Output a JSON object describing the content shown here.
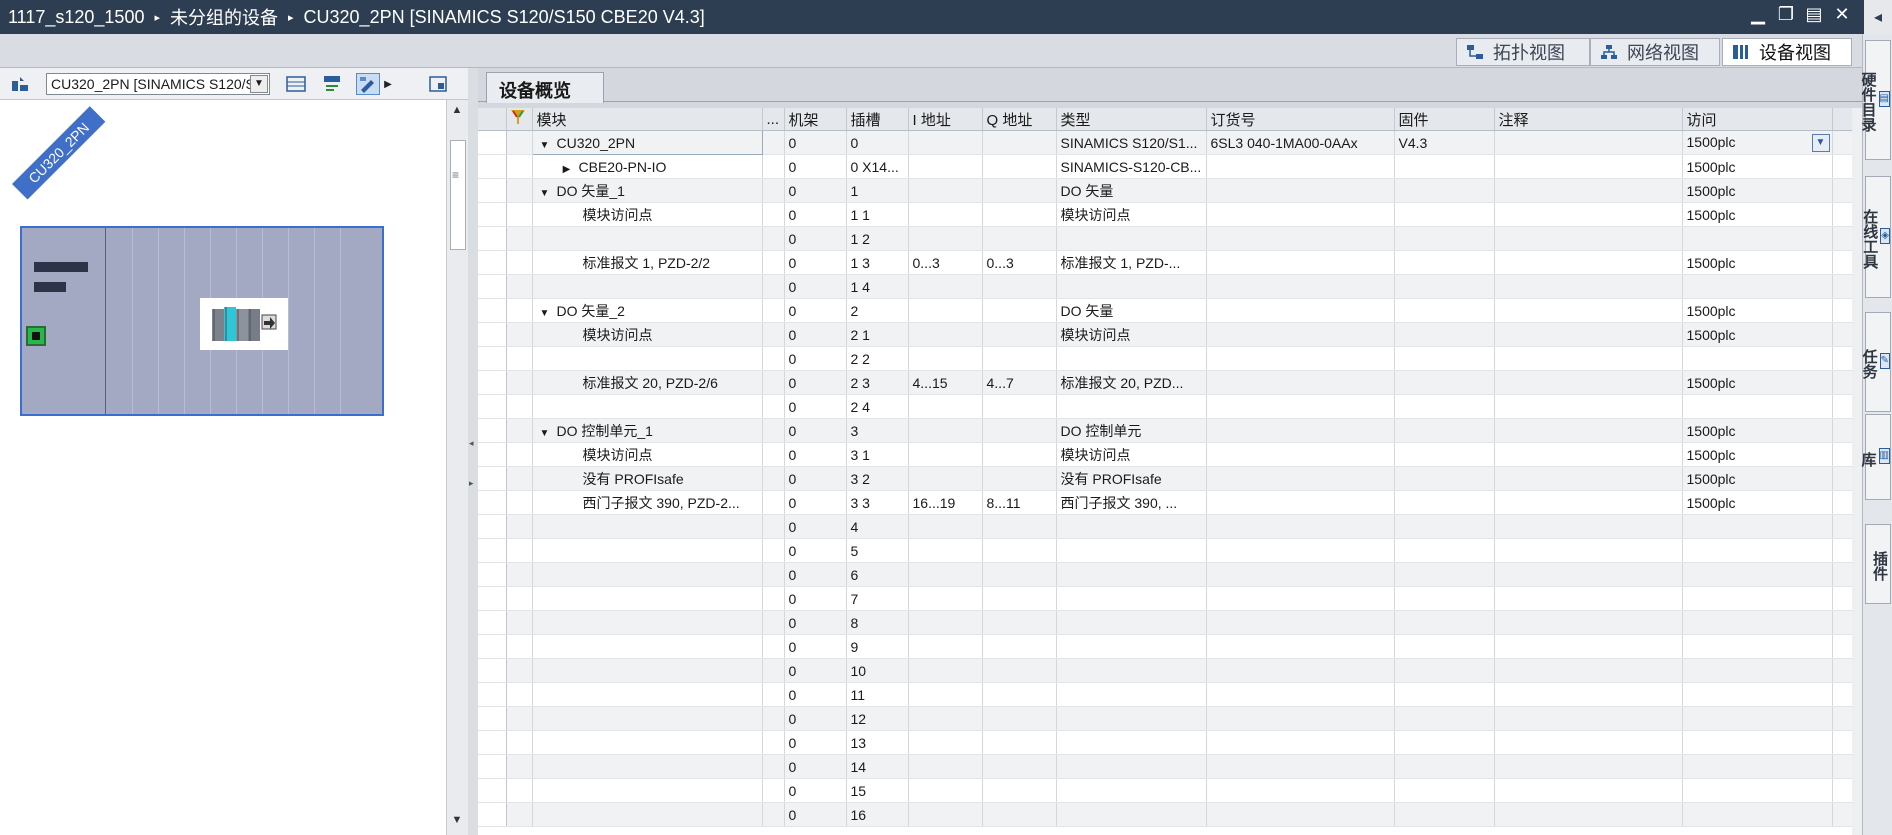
{
  "titlebar": {
    "crumbs": [
      "1117_s120_1500",
      "未分组的设备",
      "CU320_2PN [SINAMICS S120/S150 CBE20 V4.3]"
    ],
    "separator": "▸",
    "min": "▁",
    "restore": "❐",
    "tile": "▤",
    "close": "✕",
    "collapse": "◂"
  },
  "viewtabs": [
    {
      "label": "拓扑视图",
      "icon": "topology-icon"
    },
    {
      "label": "网络视图",
      "icon": "network-icon"
    },
    {
      "label": "设备视图",
      "icon": "device-icon",
      "active": true
    }
  ],
  "left": {
    "device_select": "CU320_2PN [SINAMICS S120/S",
    "device_label": "CU320_2PN"
  },
  "table_tab": "设备概览",
  "columns": {
    "module": "模块",
    "dots": "...",
    "rack": "机架",
    "slot": "插槽",
    "iaddr": "I 地址",
    "qaddr": "Q 地址",
    "type": "类型",
    "order": "订货号",
    "firmware": "固件",
    "comment": "注释",
    "access": "访问"
  },
  "rows": [
    {
      "module": "CU320_2PN",
      "expand": "▼",
      "level": 0,
      "rack": "0",
      "slot": "0",
      "i": "",
      "q": "",
      "type": "SINAMICS S120/S1...",
      "order": "6SL3 040-1MA00-0AAx",
      "fw": "V4.3",
      "comment": "",
      "access": "1500plc",
      "selected": true
    },
    {
      "module": "CBE20-PN-IO",
      "expand": "▶",
      "level": 1,
      "rack": "0",
      "slot": "0 X14...",
      "i": "",
      "q": "",
      "type": "SINAMICS-S120-CB...",
      "order": "",
      "fw": "",
      "comment": "",
      "access": "1500plc"
    },
    {
      "module": "DO 矢量_1",
      "expand": "▼",
      "level": 0,
      "rack": "0",
      "slot": "1",
      "i": "",
      "q": "",
      "type": "DO 矢量",
      "order": "",
      "fw": "",
      "comment": "",
      "access": "1500plc"
    },
    {
      "module": "模块访问点",
      "expand": "",
      "level": 1,
      "rack": "0",
      "slot": "1 1",
      "i": "",
      "q": "",
      "type": "模块访问点",
      "order": "",
      "fw": "",
      "comment": "",
      "access": "1500plc"
    },
    {
      "module": "",
      "expand": "",
      "level": 1,
      "rack": "0",
      "slot": "1 2",
      "i": "",
      "q": "",
      "type": "",
      "order": "",
      "fw": "",
      "comment": "",
      "access": ""
    },
    {
      "module": "标准报文 1, PZD-2/2",
      "expand": "",
      "level": 1,
      "rack": "0",
      "slot": "1 3",
      "i": "0...3",
      "q": "0...3",
      "type": "标准报文 1, PZD-...",
      "order": "",
      "fw": "",
      "comment": "",
      "access": "1500plc"
    },
    {
      "module": "",
      "expand": "",
      "level": 1,
      "rack": "0",
      "slot": "1 4",
      "i": "",
      "q": "",
      "type": "",
      "order": "",
      "fw": "",
      "comment": "",
      "access": ""
    },
    {
      "module": "DO 矢量_2",
      "expand": "▼",
      "level": 0,
      "rack": "0",
      "slot": "2",
      "i": "",
      "q": "",
      "type": "DO 矢量",
      "order": "",
      "fw": "",
      "comment": "",
      "access": "1500plc"
    },
    {
      "module": "模块访问点",
      "expand": "",
      "level": 1,
      "rack": "0",
      "slot": "2 1",
      "i": "",
      "q": "",
      "type": "模块访问点",
      "order": "",
      "fw": "",
      "comment": "",
      "access": "1500plc"
    },
    {
      "module": "",
      "expand": "",
      "level": 1,
      "rack": "0",
      "slot": "2 2",
      "i": "",
      "q": "",
      "type": "",
      "order": "",
      "fw": "",
      "comment": "",
      "access": ""
    },
    {
      "module": "标准报文 20, PZD-2/6",
      "expand": "",
      "level": 1,
      "rack": "0",
      "slot": "2 3",
      "i": "4...15",
      "q": "4...7",
      "type": "标准报文 20, PZD...",
      "order": "",
      "fw": "",
      "comment": "",
      "access": "1500plc"
    },
    {
      "module": "",
      "expand": "",
      "level": 1,
      "rack": "0",
      "slot": "2 4",
      "i": "",
      "q": "",
      "type": "",
      "order": "",
      "fw": "",
      "comment": "",
      "access": ""
    },
    {
      "module": "DO 控制单元_1",
      "expand": "▼",
      "level": 0,
      "rack": "0",
      "slot": "3",
      "i": "",
      "q": "",
      "type": "DO 控制单元",
      "order": "",
      "fw": "",
      "comment": "",
      "access": "1500plc"
    },
    {
      "module": "模块访问点",
      "expand": "",
      "level": 1,
      "rack": "0",
      "slot": "3 1",
      "i": "",
      "q": "",
      "type": "模块访问点",
      "order": "",
      "fw": "",
      "comment": "",
      "access": "1500plc"
    },
    {
      "module": "没有 PROFIsafe",
      "expand": "",
      "level": 1,
      "rack": "0",
      "slot": "3 2",
      "i": "",
      "q": "",
      "type": "没有 PROFIsafe",
      "order": "",
      "fw": "",
      "comment": "",
      "access": "1500plc"
    },
    {
      "module": "西门子报文 390, PZD-2...",
      "expand": "",
      "level": 1,
      "rack": "0",
      "slot": "3 3",
      "i": "16...19",
      "q": "8...11",
      "type": "西门子报文 390, ...",
      "order": "",
      "fw": "",
      "comment": "",
      "access": "1500plc"
    },
    {
      "module": "",
      "expand": "",
      "level": 0,
      "rack": "0",
      "slot": "4",
      "i": "",
      "q": "",
      "type": "",
      "order": "",
      "fw": "",
      "comment": "",
      "access": ""
    },
    {
      "module": "",
      "expand": "",
      "level": 0,
      "rack": "0",
      "slot": "5",
      "i": "",
      "q": "",
      "type": "",
      "order": "",
      "fw": "",
      "comment": "",
      "access": ""
    },
    {
      "module": "",
      "expand": "",
      "level": 0,
      "rack": "0",
      "slot": "6",
      "i": "",
      "q": "",
      "type": "",
      "order": "",
      "fw": "",
      "comment": "",
      "access": ""
    },
    {
      "module": "",
      "expand": "",
      "level": 0,
      "rack": "0",
      "slot": "7",
      "i": "",
      "q": "",
      "type": "",
      "order": "",
      "fw": "",
      "comment": "",
      "access": ""
    },
    {
      "module": "",
      "expand": "",
      "level": 0,
      "rack": "0",
      "slot": "8",
      "i": "",
      "q": "",
      "type": "",
      "order": "",
      "fw": "",
      "comment": "",
      "access": ""
    },
    {
      "module": "",
      "expand": "",
      "level": 0,
      "rack": "0",
      "slot": "9",
      "i": "",
      "q": "",
      "type": "",
      "order": "",
      "fw": "",
      "comment": "",
      "access": ""
    },
    {
      "module": "",
      "expand": "",
      "level": 0,
      "rack": "0",
      "slot": "10",
      "i": "",
      "q": "",
      "type": "",
      "order": "",
      "fw": "",
      "comment": "",
      "access": ""
    },
    {
      "module": "",
      "expand": "",
      "level": 0,
      "rack": "0",
      "slot": "11",
      "i": "",
      "q": "",
      "type": "",
      "order": "",
      "fw": "",
      "comment": "",
      "access": ""
    },
    {
      "module": "",
      "expand": "",
      "level": 0,
      "rack": "0",
      "slot": "12",
      "i": "",
      "q": "",
      "type": "",
      "order": "",
      "fw": "",
      "comment": "",
      "access": ""
    },
    {
      "module": "",
      "expand": "",
      "level": 0,
      "rack": "0",
      "slot": "13",
      "i": "",
      "q": "",
      "type": "",
      "order": "",
      "fw": "",
      "comment": "",
      "access": ""
    },
    {
      "module": "",
      "expand": "",
      "level": 0,
      "rack": "0",
      "slot": "14",
      "i": "",
      "q": "",
      "type": "",
      "order": "",
      "fw": "",
      "comment": "",
      "access": ""
    },
    {
      "module": "",
      "expand": "",
      "level": 0,
      "rack": "0",
      "slot": "15",
      "i": "",
      "q": "",
      "type": "",
      "order": "",
      "fw": "",
      "comment": "",
      "access": ""
    },
    {
      "module": "",
      "expand": "",
      "level": 0,
      "rack": "0",
      "slot": "16",
      "i": "",
      "q": "",
      "type": "",
      "order": "",
      "fw": "",
      "comment": "",
      "access": ""
    }
  ],
  "taskcards": [
    "硬件目录",
    "在线工具",
    "任务",
    "库",
    "插件"
  ]
}
